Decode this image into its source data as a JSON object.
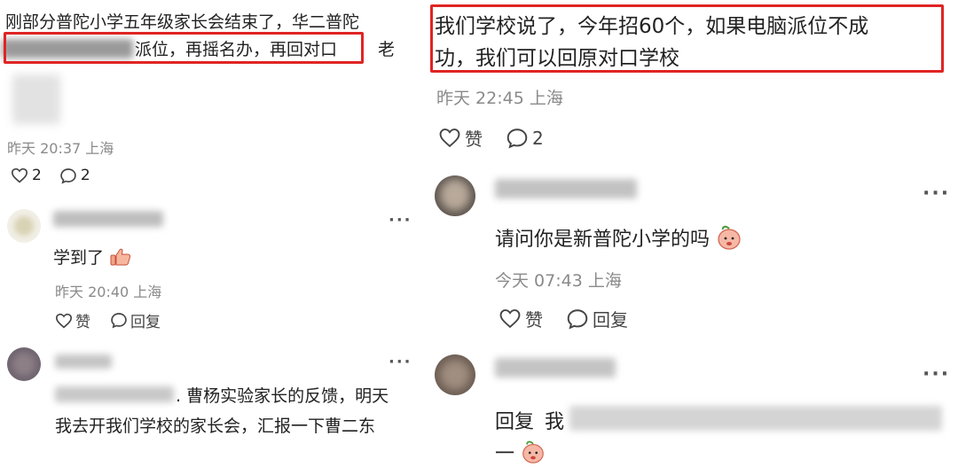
{
  "left": {
    "post": {
      "line1": "刚部分普陀小学五年级家长会结束了，华二普陀",
      "line2_visible": "派位，再摇名办，再回对口",
      "line2_tail": "老",
      "time": "昨天 20:37 上海",
      "likes": "2",
      "comments": "2"
    },
    "reply1": {
      "text": "学到了",
      "time": "昨天 20:40 上海",
      "like_label": "赞",
      "reply_label": "回复"
    },
    "reply2": {
      "line1": ". 曹杨实验家长的反馈，明天",
      "line2": "我去开我们学校的家长会，汇报一下曹二东"
    }
  },
  "right": {
    "post": {
      "line1": "我们学校说了，今年招60个，如果电脑派位不成",
      "line2": "功，我们可以回原对口学校",
      "time": "昨天 22:45 上海",
      "like_label": "赞",
      "comments": "2"
    },
    "reply1": {
      "text": "请问你是新普陀小学的吗",
      "time": "今天 07:43 上海",
      "like_label": "赞",
      "reply_label": "回复"
    },
    "reply2": {
      "prefix": "回复",
      "partial": "我",
      "line2": "一"
    }
  },
  "colors": {
    "highlight": "#e02424",
    "meta": "#8a8a8a"
  },
  "icons": [
    "heart-icon",
    "comment-bubble-icon",
    "more-dots-icon",
    "thumbs-up-emoji",
    "peach-face-emoji"
  ]
}
